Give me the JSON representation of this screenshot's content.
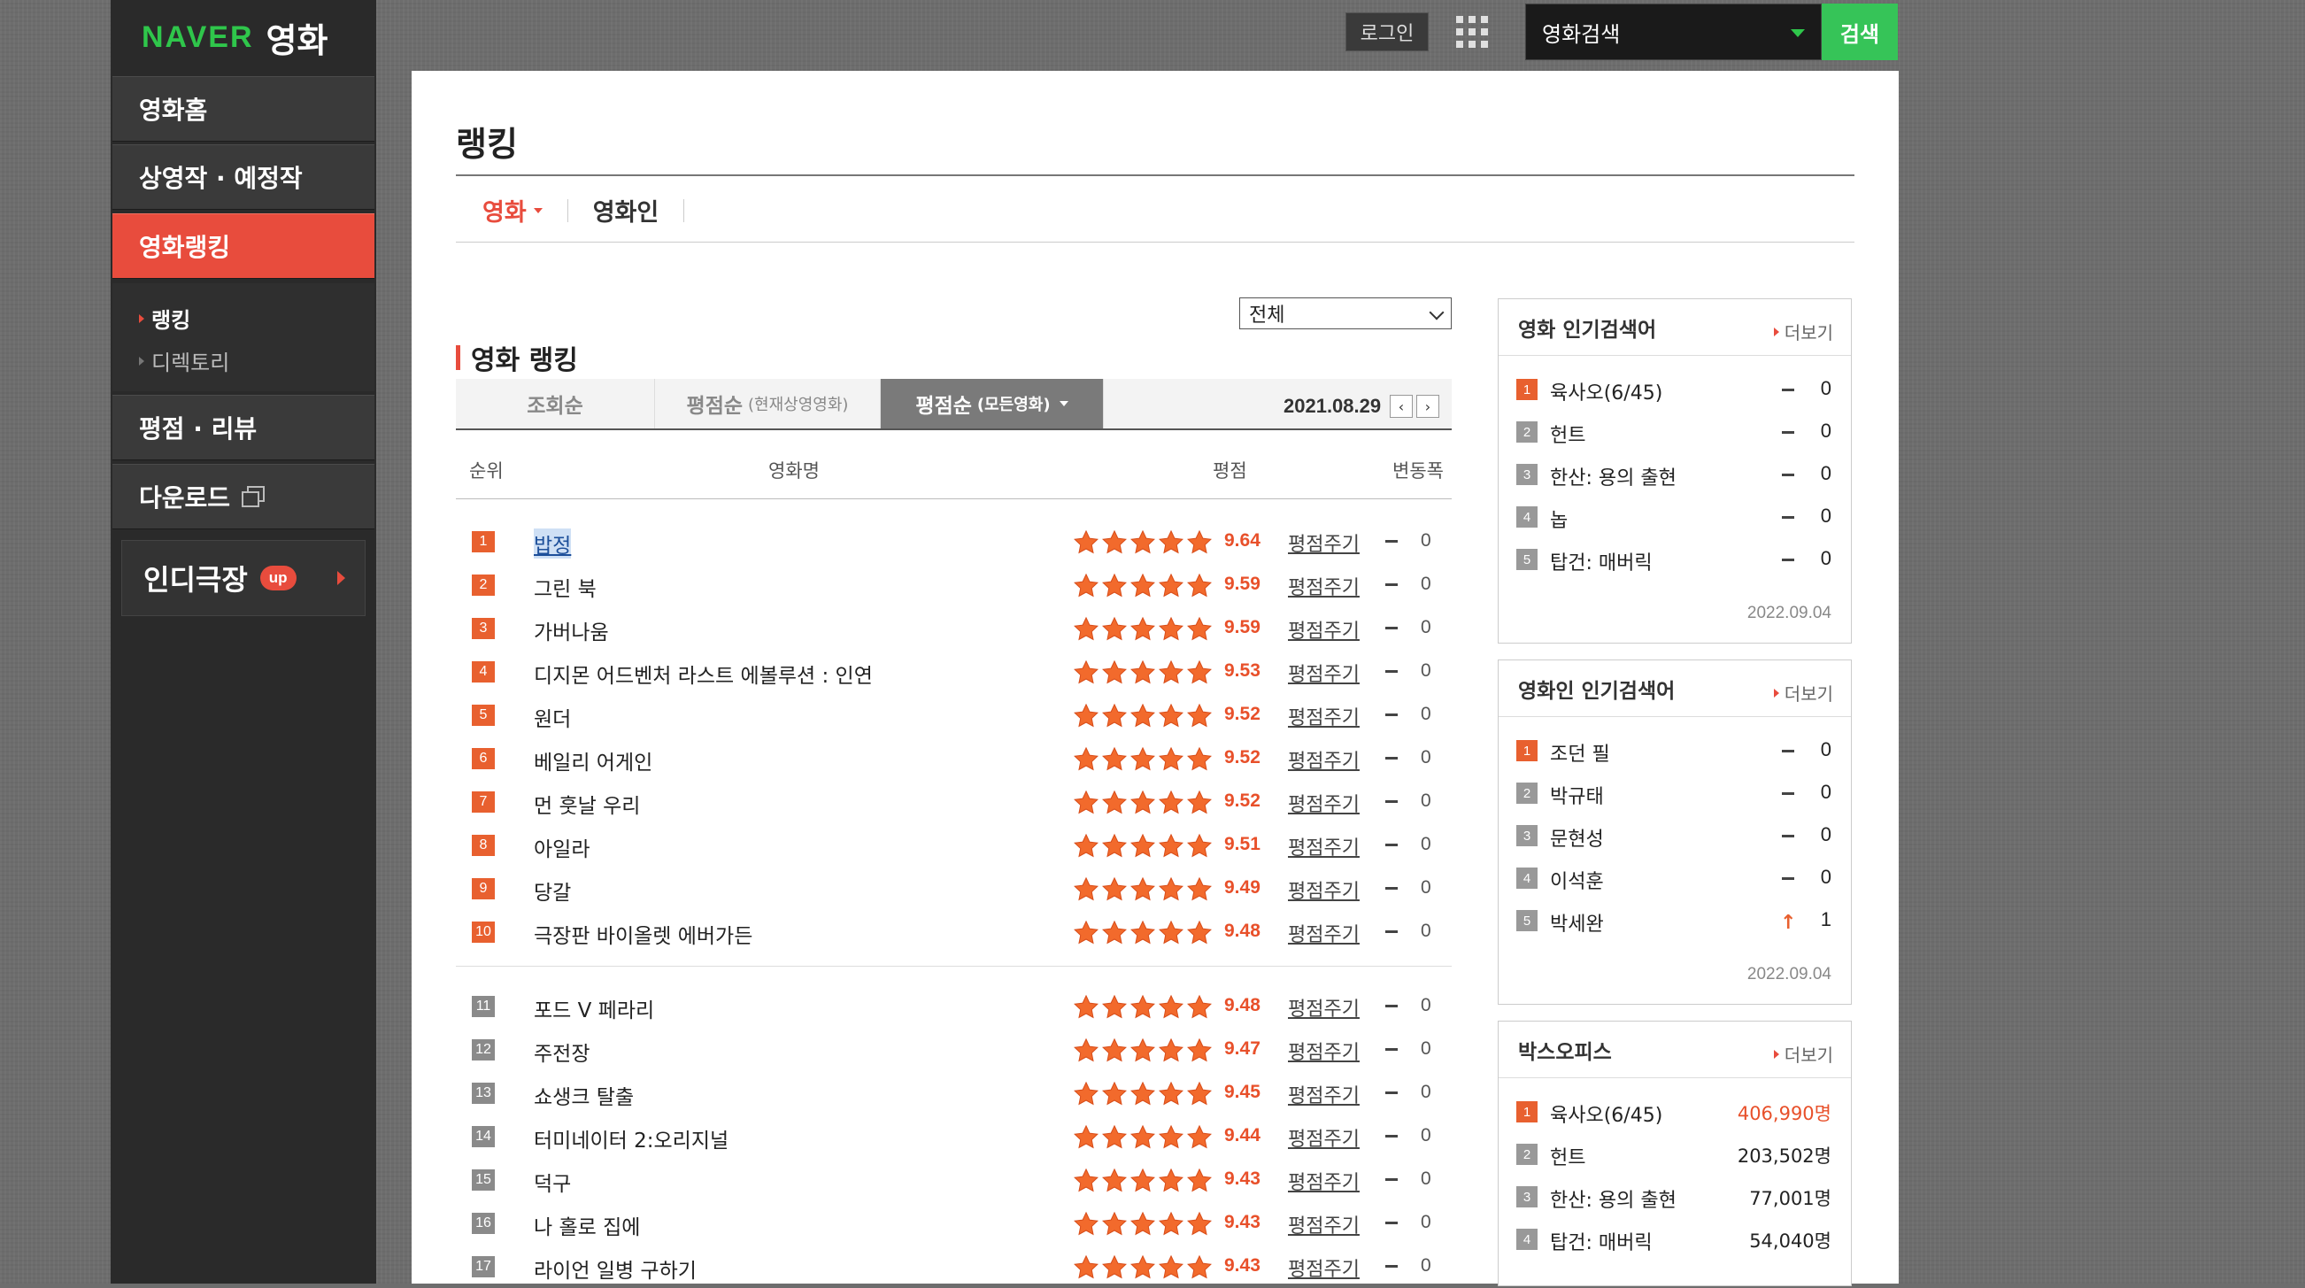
{
  "header": {
    "logo_brand": "NAVER",
    "logo_service": "영화",
    "login": "로그인",
    "search_select": "영화검색",
    "search_button": "검색"
  },
  "sidebar": {
    "items": [
      {
        "label": "영화홈"
      },
      {
        "label": "상영작 · 예정작"
      },
      {
        "label": "영화랭킹",
        "active": true
      },
      {
        "label": "평점 · 리뷰"
      },
      {
        "label": "다운로드"
      }
    ],
    "sub": [
      {
        "label": "랭킹",
        "active": true
      },
      {
        "label": "디렉토리"
      }
    ],
    "indie": {
      "label": "인디극장",
      "badge": "up"
    }
  },
  "main": {
    "page_title": "랭킹",
    "tabs": [
      "영화",
      "영화인"
    ],
    "filter": "전체",
    "section_title": "영화 랭킹",
    "sort_tabs": [
      {
        "label": "조회순",
        "sub": ""
      },
      {
        "label": "평점순",
        "sub": "(현재상영영화)"
      },
      {
        "label": "평점순",
        "sub": "(모든영화)",
        "active": true
      }
    ],
    "date": "2021.08.29",
    "columns": {
      "rank": "순위",
      "title": "영화명",
      "score": "평점",
      "change": "변동폭"
    },
    "rate_label": "평점주기",
    "star_rating": 5,
    "rows": [
      {
        "rank": "1",
        "title": "밥정",
        "score": "9.64",
        "change": "0"
      },
      {
        "rank": "2",
        "title": "그린 북",
        "score": "9.59",
        "change": "0"
      },
      {
        "rank": "3",
        "title": "가버나움",
        "score": "9.59",
        "change": "0"
      },
      {
        "rank": "4",
        "title": "디지몬 어드벤처 라스트 에볼루션 : 인연",
        "score": "9.53",
        "change": "0"
      },
      {
        "rank": "5",
        "title": "원더",
        "score": "9.52",
        "change": "0"
      },
      {
        "rank": "6",
        "title": "베일리 어게인",
        "score": "9.52",
        "change": "0"
      },
      {
        "rank": "7",
        "title": "먼 훗날 우리",
        "score": "9.52",
        "change": "0"
      },
      {
        "rank": "8",
        "title": "아일라",
        "score": "9.51",
        "change": "0"
      },
      {
        "rank": "9",
        "title": "당갈",
        "score": "9.49",
        "change": "0"
      },
      {
        "rank": "10",
        "title": "극장판 바이올렛 에버가든",
        "score": "9.48",
        "change": "0"
      },
      {
        "rank": "11",
        "title": "포드 V 페라리",
        "score": "9.48",
        "change": "0"
      },
      {
        "rank": "12",
        "title": "주전장",
        "score": "9.47",
        "change": "0"
      },
      {
        "rank": "13",
        "title": "쇼생크 탈출",
        "score": "9.45",
        "change": "0"
      },
      {
        "rank": "14",
        "title": "터미네이터 2:오리지널",
        "score": "9.44",
        "change": "0"
      },
      {
        "rank": "15",
        "title": "덕구",
        "score": "9.43",
        "change": "0"
      },
      {
        "rank": "16",
        "title": "나 홀로 집에",
        "score": "9.43",
        "change": "0"
      },
      {
        "rank": "17",
        "title": "라이언 일병 구하기",
        "score": "9.43",
        "change": "0"
      }
    ]
  },
  "right": {
    "more_label": "더보기",
    "movie_search": {
      "title": "영화 인기검색어",
      "date": "2022.09.04",
      "items": [
        {
          "rank": "1",
          "name": "육사오(6/45)",
          "change": "0"
        },
        {
          "rank": "2",
          "name": "헌트",
          "change": "0"
        },
        {
          "rank": "3",
          "name": "한산: 용의 출현",
          "change": "0"
        },
        {
          "rank": "4",
          "name": "놉",
          "change": "0"
        },
        {
          "rank": "5",
          "name": "탑건: 매버릭",
          "change": "0"
        }
      ]
    },
    "people_search": {
      "title": "영화인 인기검색어",
      "date": "2022.09.04",
      "items": [
        {
          "rank": "1",
          "name": "조던 필",
          "change": "0"
        },
        {
          "rank": "2",
          "name": "박규태",
          "change": "0"
        },
        {
          "rank": "3",
          "name": "문현성",
          "change": "0"
        },
        {
          "rank": "4",
          "name": "이석훈",
          "change": "0"
        },
        {
          "rank": "5",
          "name": "박세완",
          "change": "1",
          "trend": "up"
        }
      ]
    },
    "boxoffice": {
      "title": "박스오피스",
      "items": [
        {
          "rank": "1",
          "name": "육사오(6/45)",
          "audience": "406,990명"
        },
        {
          "rank": "2",
          "name": "헌트",
          "audience": "203,502명"
        },
        {
          "rank": "3",
          "name": "한산: 용의 출현",
          "audience": "77,001명"
        },
        {
          "rank": "4",
          "name": "탑건: 매버릭",
          "audience": "54,040명"
        }
      ]
    }
  },
  "colors": {
    "accent": "#e84c3d",
    "brand": "#2fc64b",
    "search_btn": "#36c458",
    "star": "#f26a2c"
  }
}
